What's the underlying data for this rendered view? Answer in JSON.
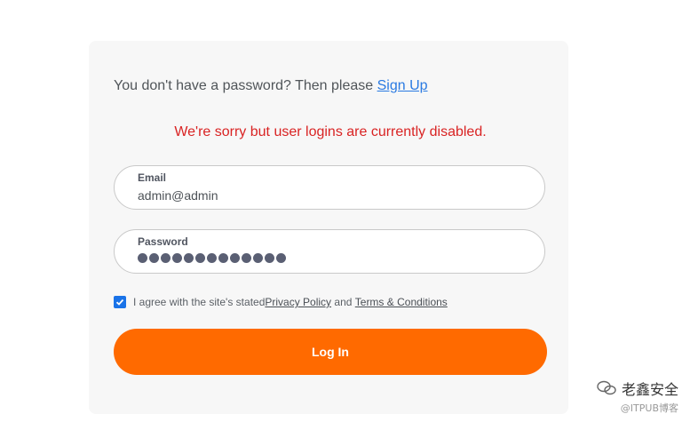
{
  "signup": {
    "prompt": "You don't have a password? Then please ",
    "link_label": "Sign Up"
  },
  "error_message": "We're sorry but user logins are currently disabled.",
  "email": {
    "label": "Email",
    "value": "admin@admin"
  },
  "password": {
    "label": "Password",
    "masked_length": 13
  },
  "agreement": {
    "checked": true,
    "text_before": "I agree with the site's stated ",
    "privacy_link": "Privacy Policy",
    "text_middle": " and ",
    "terms_link": "Terms & Conditions"
  },
  "login_button_label": "Log In",
  "watermark": {
    "main": "老鑫安全",
    "sub": "@ITPUB博客"
  },
  "colors": {
    "accent": "#ff6a00",
    "link": "#2a7ae2",
    "error": "#d92323",
    "checkbox": "#1a73e8"
  }
}
